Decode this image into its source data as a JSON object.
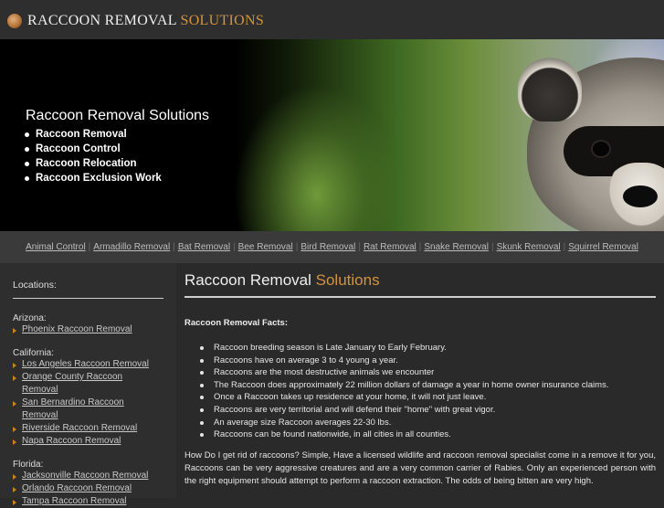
{
  "header": {
    "logo_main": "RACCOON REMOVAL",
    "logo_accent": "SOLUTIONS"
  },
  "hero": {
    "title": "Raccoon Removal Solutions",
    "bullets": [
      "Raccoon Removal",
      "Raccoon Control",
      "Raccoon Relocation",
      "Raccoon Exclusion Work"
    ]
  },
  "nav": {
    "items": [
      "Animal Control",
      "Armadillo Removal",
      "Bat Removal",
      "Bee Removal",
      "Bird Removal",
      "Rat Removal",
      "Snake Removal",
      "Skunk Removal",
      "Squirrel Removal"
    ]
  },
  "sidebar": {
    "heading": "Locations:",
    "states": [
      {
        "name": "Arizona:",
        "links": [
          "Phoenix Raccoon Removal"
        ]
      },
      {
        "name": "California:",
        "links": [
          "Los Angeles Raccoon Removal",
          "Orange County Raccoon Removal",
          "San Bernardino Raccoon Removal",
          "Riverside Raccoon Removal",
          "Napa Raccoon Removal"
        ]
      },
      {
        "name": "Florida:",
        "links": [
          "Jacksonville Raccoon Removal",
          "Orlando Raccoon Removal",
          "Tampa Raccoon Removal"
        ]
      }
    ]
  },
  "main": {
    "title_main": "Raccoon Removal",
    "title_accent": "Solutions",
    "facts_heading": "Raccoon Removal Facts:",
    "facts": [
      "Raccoon breeding season is Late January to Early February.",
      "Raccoons have on average 3 to 4 young a year.",
      "Raccoons are the most destructive animals we encounter",
      "The Raccoon does approximately 22 million dollars of damage a year in home owner insurance claims.",
      "Once a Raccoon takes up residence at your home, it will not just leave.",
      "Raccoons are very territorial and will defend their \"home\" with great vigor.",
      "An average size Raccoon averages 22-30 lbs.",
      "Raccoons can be found nationwide, in all cities in all counties."
    ],
    "paragraph": "How Do I get rid of raccoons? Simple, Have a licensed wildlife and raccoon removal specialist come in a remove it for you, Raccoons can be very aggressive creatures and are a very common carrier of Rabies. Only an experienced person with the right equipment should attempt to perform a raccoon extraction. The odds of being bitten are very high."
  },
  "colors": {
    "accent": "#d2933f",
    "background": "#2a2a2a",
    "nav_bg": "#3a3a3a"
  }
}
